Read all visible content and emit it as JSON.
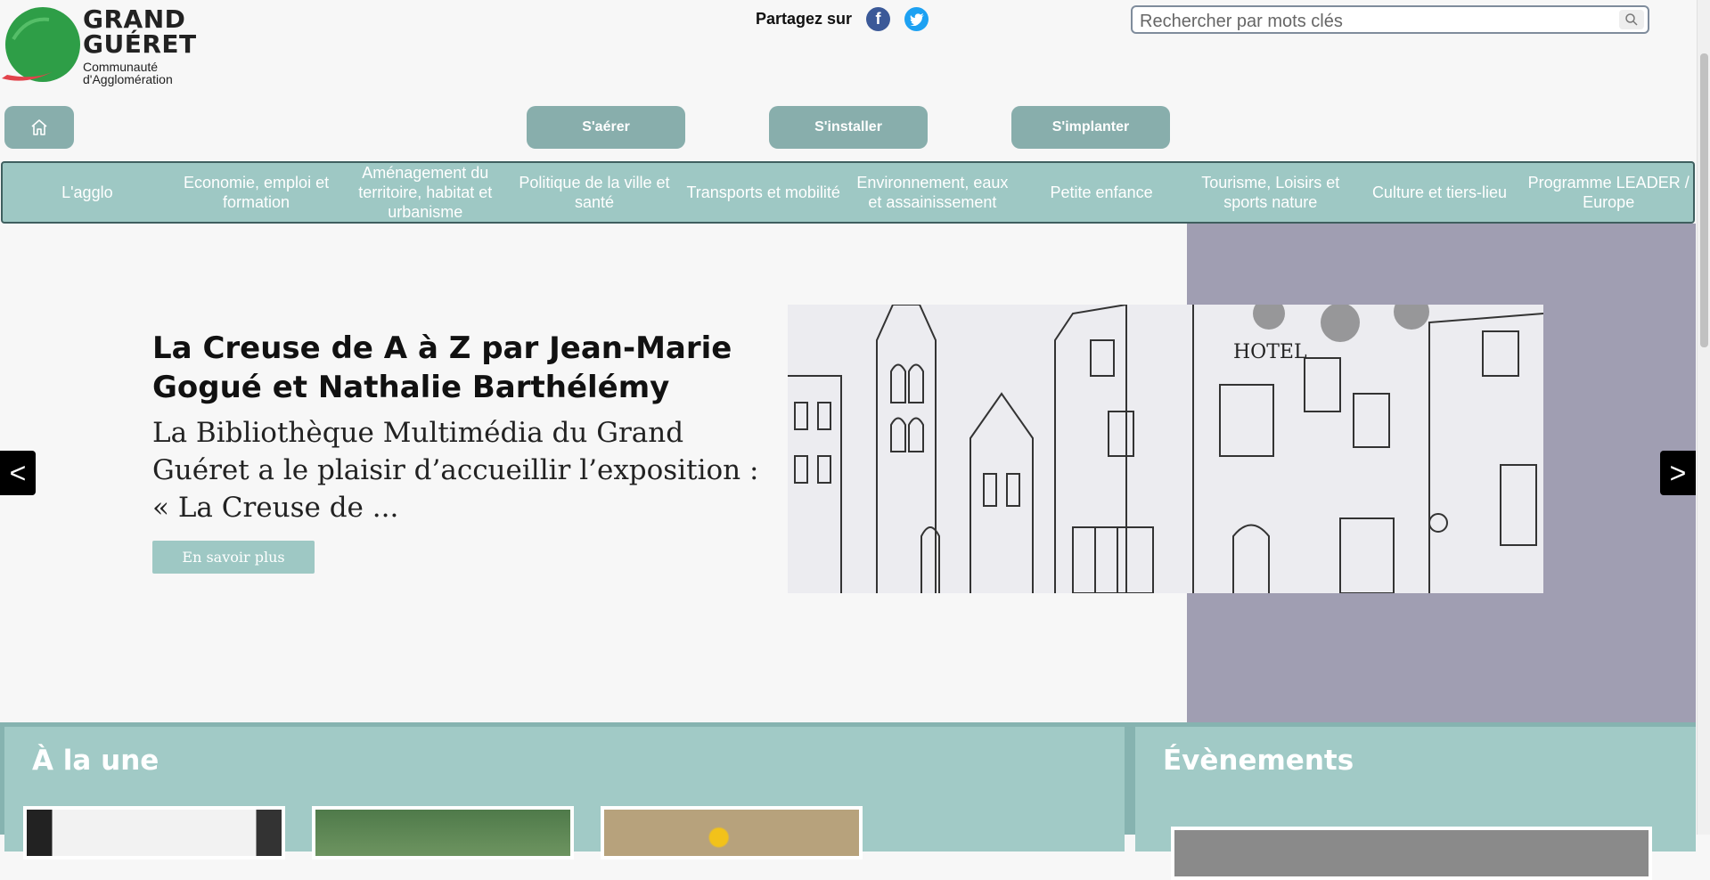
{
  "header": {
    "logo_line1": "GRAND",
    "logo_line2": "GUÉRET",
    "logo_line3": "Communauté",
    "logo_line4": "d'Agglomération",
    "share_label": "Partagez sur",
    "social": [
      {
        "icon": "facebook-icon",
        "glyph": "f"
      },
      {
        "icon": "twitter-icon",
        "glyph": "t"
      }
    ],
    "search_placeholder": "Rechercher par mots clés"
  },
  "quick_nav": {
    "home_icon": "home-icon",
    "items": [
      "S'aérer",
      "S'installer",
      "S'implanter"
    ]
  },
  "main_nav": {
    "items": [
      "L'agglo",
      "Economie, emploi et formation",
      "Aménagement du territoire, habitat et urbanisme",
      "Politique de la ville et santé",
      "Transports et mobilité",
      "Environnement, eaux et assainissement",
      "Petite enfance",
      "Tourisme, Loisirs et sports nature",
      "Culture et tiers-lieu",
      "Programme LEADER / Europe"
    ]
  },
  "hero": {
    "title": "La Creuse de A à Z par Jean-Marie Gogué et Nathalie Barthélémy",
    "description": "La Bibliothèque Multimédia du Grand Guéret a le plaisir d’accueillir l’exposition : « La Creuse de ...",
    "button": "En savoir plus",
    "prev": "<",
    "next": ">",
    "image_sign": "HOTEL"
  },
  "sections": {
    "une_title": "À la une",
    "events_title": "Évènements"
  },
  "colors": {
    "accent": "#9ec8c4",
    "pill": "#88aeac",
    "hero_band": "#a09eb2",
    "logo_green": "#2e9e47",
    "logo_red": "#e2434b"
  }
}
